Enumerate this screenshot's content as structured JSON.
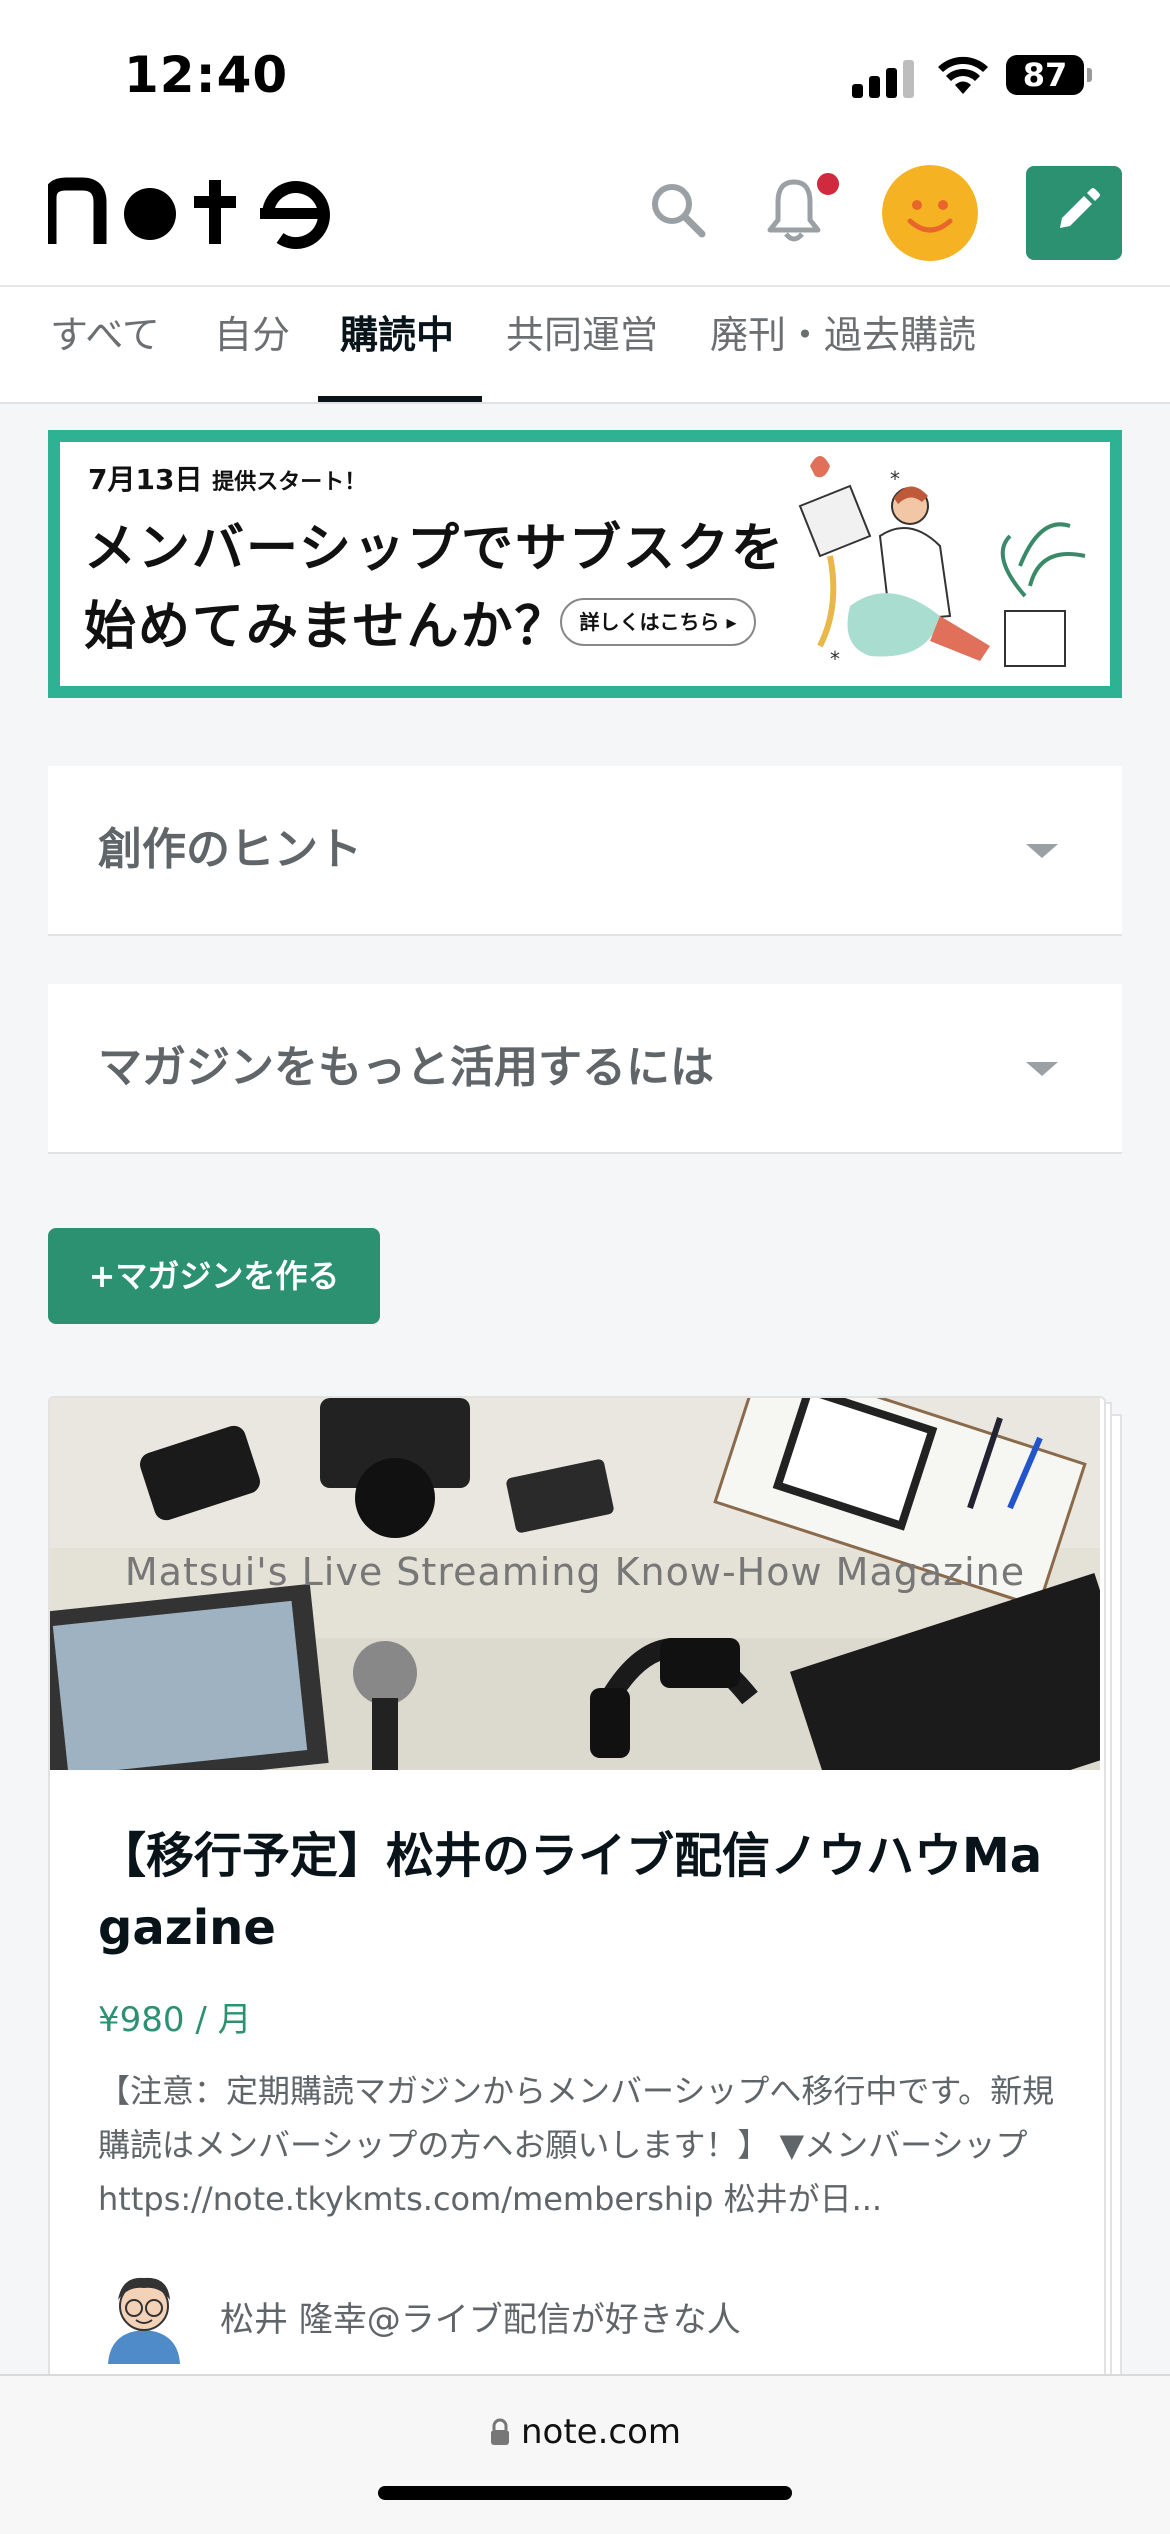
{
  "status_bar": {
    "time": "12:40",
    "battery": "87"
  },
  "header": {
    "logo": "note",
    "search_icon": "search-icon",
    "bell_icon": "bell-icon",
    "post_icon": "pencil-icon"
  },
  "tabs": [
    {
      "label": "すべて"
    },
    {
      "label": "自分"
    },
    {
      "label": "購読中",
      "active": true
    },
    {
      "label": "共同運営"
    },
    {
      "label": "廃刊・過去購読"
    }
  ],
  "banner": {
    "date": "7月13日",
    "date_suffix": "提供スタート！",
    "line1": "メンバーシップでサブスクを",
    "line2": "始めてみませんか？",
    "button": "詳しくはこちら ▸"
  },
  "accordions": [
    {
      "label": "創作のヒント"
    },
    {
      "label": "マガジンをもっと活用するには"
    }
  ],
  "create_button": "+マガジンを作る",
  "magazine": {
    "cover_text": "Matsui's Live Streaming Know-How Magazine",
    "title": "【移行予定】松井のライブ配信ノウハウMagazine",
    "price": "¥980 / 月",
    "description": "【注意：定期購読マガジンからメンバーシップへ移行中です。新規購読はメンバーシップの方へお願いします！】 ▼メンバーシップ https://note.tkykmts.com/membership 松井が日...",
    "author": "松井 隆幸@ライブ配信が好きな人"
  },
  "browser": {
    "url": "note.com"
  },
  "colors": {
    "brand_green": "#2c9170",
    "banner_green": "#2fb294",
    "notif_red": "#d1293d",
    "avatar_yellow": "#f5b324"
  }
}
